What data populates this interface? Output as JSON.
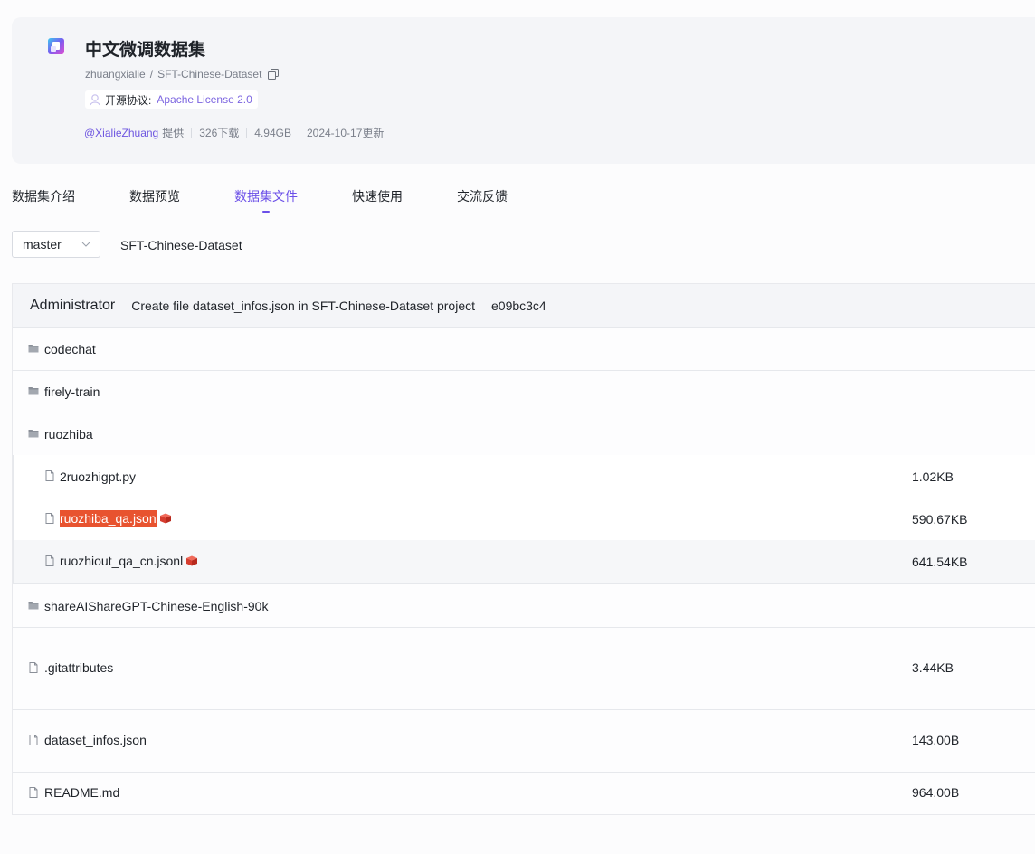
{
  "dataset": {
    "title": "中文微调数据集",
    "owner": "zhuangxialie",
    "path_sep": "/",
    "repo": "SFT-Chinese-Dataset",
    "license_label": "开源协议:",
    "license_value": "Apache License 2.0",
    "author": "@XialieZhuang",
    "provided": "提供",
    "downloads": "326下载",
    "size": "4.94GB",
    "updated": "2024-10-17更新"
  },
  "tabs": [
    "数据集介绍",
    "数据预览",
    "数据集文件",
    "快速使用",
    "交流反馈"
  ],
  "active_tab": 2,
  "branch": {
    "selected": "master"
  },
  "breadcrumb": "SFT-Chinese-Dataset",
  "commit": {
    "author": "Administrator",
    "message": "Create file dataset_infos.json in SFT-Chinese-Dataset project",
    "hash": "e09bc3c4"
  },
  "files": [
    {
      "name": "codechat",
      "type": "folder",
      "size": ""
    },
    {
      "name": "firely-train",
      "type": "folder",
      "size": ""
    },
    {
      "name": "ruozhiba",
      "type": "folder",
      "size": ""
    },
    {
      "name": "2ruozhigpt.py",
      "type": "file",
      "size": "1.02KB"
    },
    {
      "name": "ruozhiba_qa.json",
      "type": "file",
      "size": "590.67KB"
    },
    {
      "name": "ruozhiout_qa_cn.jsonl",
      "type": "file",
      "size": "641.54KB"
    },
    {
      "name": "shareAIShareGPT-Chinese-English-90k",
      "type": "folder",
      "size": ""
    },
    {
      "name": ".gitattributes",
      "type": "file",
      "size": "3.44KB"
    },
    {
      "name": "dataset_infos.json",
      "type": "file",
      "size": "143.00B"
    },
    {
      "name": "README.md",
      "type": "file",
      "size": "964.00B"
    }
  ],
  "colors": {
    "accent": "#6b4fe8",
    "highlight": "#e8532f"
  }
}
